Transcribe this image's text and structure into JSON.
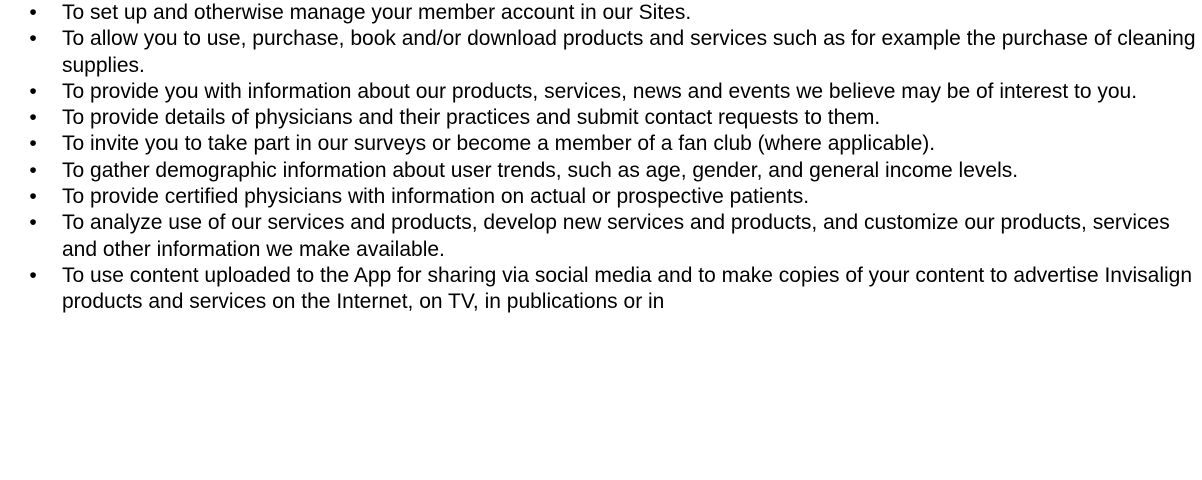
{
  "bullet_glyph": "•",
  "items": [
    "To set up and otherwise manage your member account in our Sites.",
    "To allow you to use, purchase, book and/or download products and services such as for example the purchase of cleaning supplies.",
    "To provide you with information about our products, services, news and events we believe may be of interest to you.",
    "To provide details of physicians and their practices and submit contact requests to them.",
    "To invite you to take part in our surveys or become a member of a fan club (where applicable).",
    "To gather demographic information about user trends, such as age, gender, and general income levels.",
    "To provide certified physicians with information on actual or prospective patients.",
    "To analyze use of our services and products, develop new services and products, and customize our products, services and other information we make available.",
    "To use content uploaded to the App for sharing via social media and to make copies of your content to advertise Invisalign products and services on the Internet, on TV, in publications or in"
  ]
}
